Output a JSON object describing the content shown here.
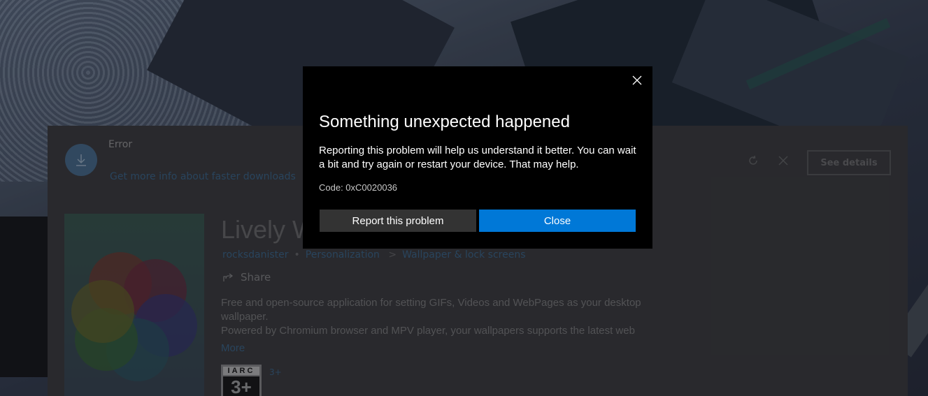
{
  "store": {
    "download_status": "Error",
    "download_link": "Get more info about faster downloads",
    "see_details_label": "See details",
    "app_title": "Lively W",
    "publisher": "rocksdanister",
    "category": "Personalization",
    "breadcrumb_separator": ">",
    "subcategory": "Wallpaper & lock screens",
    "share_label": "Share",
    "description_line1": "Free and open-source application for setting GIFs, Videos and WebPages as your desktop",
    "description_line2": "wallpaper.",
    "description_line3": "Powered by Chromium browser and MPV player, your wallpapers supports the latest web",
    "more_label": "More",
    "iarc_header": "IARC",
    "iarc_age": "3+",
    "iarc_label": "3+"
  },
  "dialog": {
    "title": "Something unexpected happened",
    "message": "Reporting this problem will help us understand it better. You can wait a bit and try again or restart your device. That may help.",
    "code": "Code: 0xC0020036",
    "report_button": "Report this problem",
    "close_button": "Close"
  },
  "colors": {
    "accent": "#0078d7",
    "dialog_background": "#000000",
    "secondary_button": "#333333"
  },
  "icons": [
    "download-icon",
    "refresh-icon",
    "cancel-icon",
    "share-icon",
    "close-icon"
  ]
}
